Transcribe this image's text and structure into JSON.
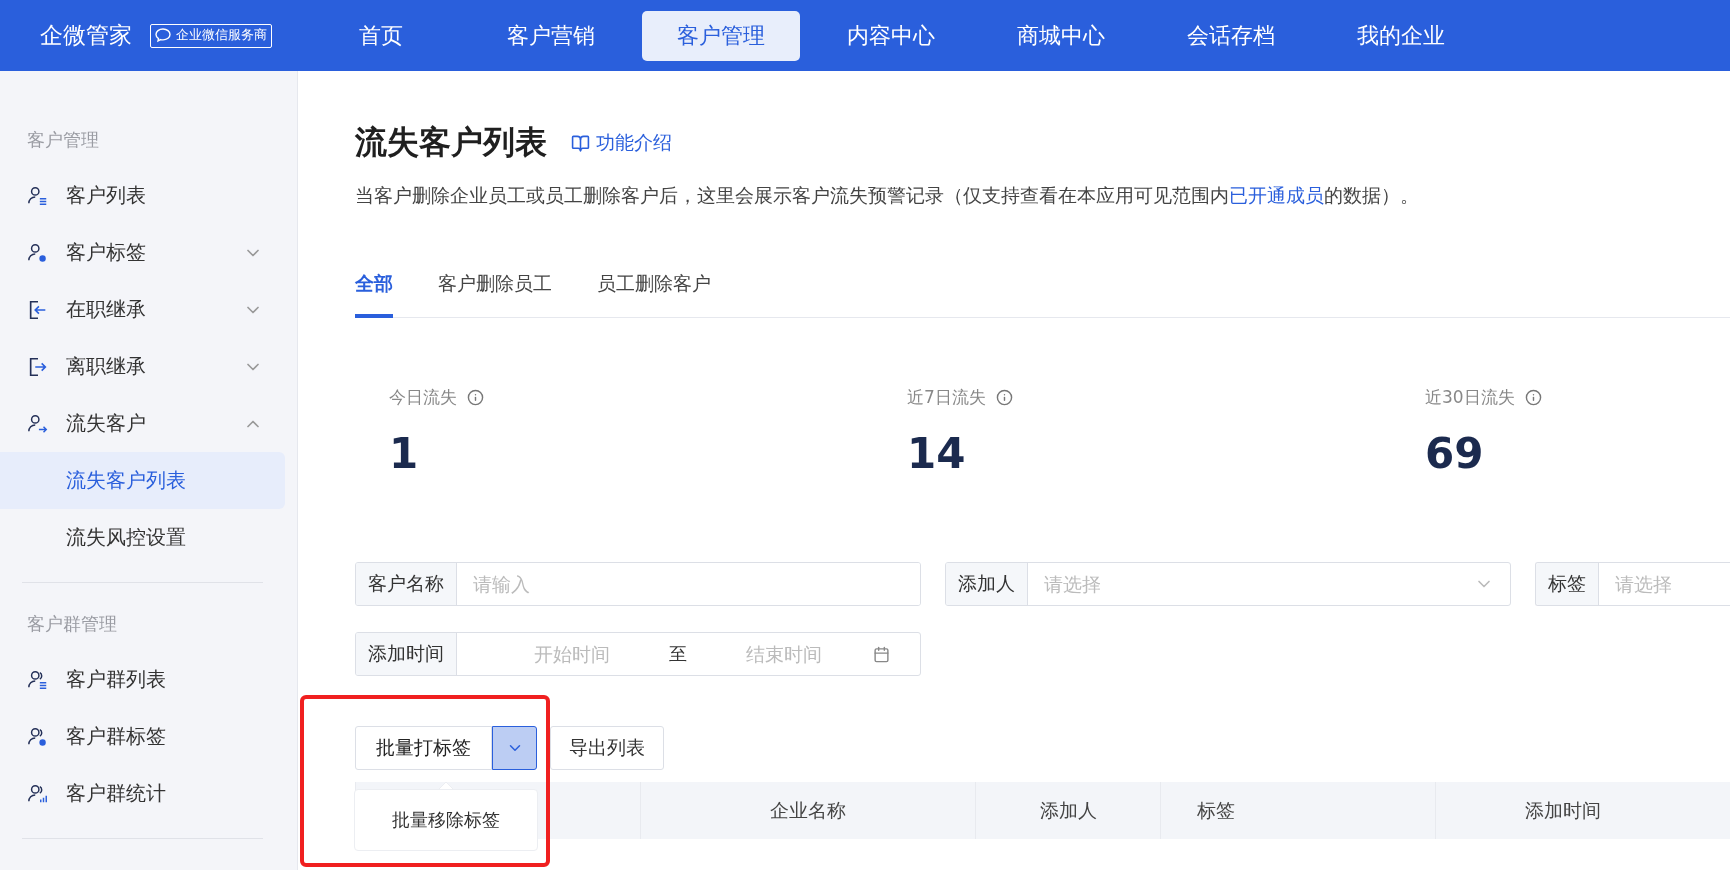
{
  "brand": {
    "name": "企微管家",
    "badge": "企业微信服务商"
  },
  "nav": [
    {
      "label": "首页",
      "selected": false
    },
    {
      "label": "客户营销",
      "selected": false
    },
    {
      "label": "客户管理",
      "selected": true
    },
    {
      "label": "内容中心",
      "selected": false
    },
    {
      "label": "商城中心",
      "selected": false
    },
    {
      "label": "会话存档",
      "selected": false
    },
    {
      "label": "我的企业",
      "selected": false
    }
  ],
  "sidebar": {
    "sections": [
      {
        "title": "客户管理",
        "items": [
          {
            "label": "客户列表",
            "kind": "user-list",
            "selected": false
          },
          {
            "label": "客户标签",
            "kind": "user-tag",
            "expanded": false,
            "selected": false
          },
          {
            "label": "在职继承",
            "kind": "enter",
            "expanded": false,
            "selected": false
          },
          {
            "label": "离职继承",
            "kind": "exit",
            "expanded": false,
            "selected": false
          },
          {
            "label": "流失客户",
            "kind": "user-out",
            "expanded": true,
            "selected": false,
            "children": [
              {
                "label": "流失客户列表",
                "selected": true
              },
              {
                "label": "流失风控设置",
                "selected": false
              }
            ]
          }
        ]
      },
      {
        "title": "客户群管理",
        "items": [
          {
            "label": "客户群列表",
            "kind": "group-list",
            "selected": false
          },
          {
            "label": "客户群标签",
            "kind": "group-tag",
            "selected": false
          },
          {
            "label": "客户群统计",
            "kind": "group-stats",
            "selected": false
          }
        ]
      }
    ]
  },
  "page": {
    "title": "流失客户列表",
    "help_link": "功能介绍",
    "description": {
      "before": "当客户删除企业员工或员工删除客户后，这里会展示客户流失预警记录（仅支持查看在本应用可见范围内",
      "link": "已开通成员",
      "after": "的数据）。"
    }
  },
  "tabs": [
    {
      "label": "全部",
      "selected": true
    },
    {
      "label": "客户删除员工",
      "selected": false
    },
    {
      "label": "员工删除客户",
      "selected": false
    }
  ],
  "stats": [
    {
      "label": "今日流失",
      "value": "1"
    },
    {
      "label": "近7日流失",
      "value": "14"
    },
    {
      "label": "近30日流失",
      "value": "69"
    }
  ],
  "filters": [
    {
      "kind": "text",
      "label": "客户名称",
      "placeholder": "请输入"
    },
    {
      "kind": "select",
      "label": "添加人",
      "placeholder": "请选择"
    },
    {
      "kind": "select-cut",
      "label": "标签",
      "placeholder": "请选择"
    },
    {
      "kind": "daterange",
      "label": "添加时间",
      "start_placeholder": "开始时间",
      "separator": "至",
      "end_placeholder": "结束时间"
    }
  ],
  "actions": {
    "split_button": "批量打标签",
    "dropdown_open": true,
    "dropdown_items": [
      "批量移除标签"
    ],
    "export_button": "导出列表"
  },
  "table": {
    "columns": [
      "企业名称",
      "添加人",
      "标签",
      "添加时间"
    ]
  }
}
